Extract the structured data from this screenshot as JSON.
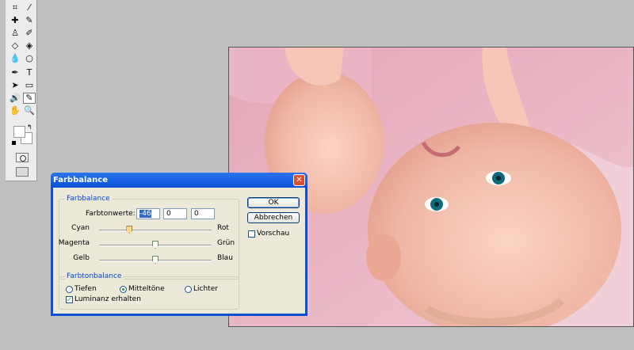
{
  "toolbox": {
    "tools": [
      "crop-icon",
      "slice-icon",
      "healing-brush-icon",
      "brush-icon",
      "stamp-icon",
      "history-brush-icon",
      "eraser-icon",
      "paint-bucket-icon",
      "blur-icon",
      "dodge-icon",
      "pen-icon",
      "type-icon",
      "path-select-icon",
      "shape-icon",
      "notes-icon",
      "eyedropper-icon",
      "hand-icon",
      "zoom-icon"
    ],
    "glyphs": [
      "⌗",
      "⁄",
      "✚",
      "✎",
      "♙",
      "✐",
      "◇",
      "◈",
      "💧",
      "○",
      "✒",
      "T",
      "➤",
      "▭",
      "🔊",
      "✎",
      "✋",
      "🔍"
    ]
  },
  "dialog": {
    "title": "Farbbalance",
    "close_glyph": "✕",
    "group1_legend": "Farbbalance",
    "tonwerte_label": "Farbtonwerte:",
    "values": [
      "-46",
      "0",
      "0"
    ],
    "sliders": [
      {
        "left": "Cyan",
        "right": "Rot",
        "value": -46
      },
      {
        "left": "Magenta",
        "right": "Grün",
        "value": 0
      },
      {
        "left": "Gelb",
        "right": "Blau",
        "value": 0
      }
    ],
    "group2_legend": "Farbtonbalance",
    "radios": [
      "Tiefen",
      "Mitteltöne",
      "Lichter"
    ],
    "selected_radio": "Mitteltöne",
    "luminanz_label": "Luminanz erhalten",
    "luminanz_checked": true,
    "ok_label": "OK",
    "cancel_label": "Abbrechen",
    "preview_label": "Vorschau",
    "preview_checked": false
  }
}
